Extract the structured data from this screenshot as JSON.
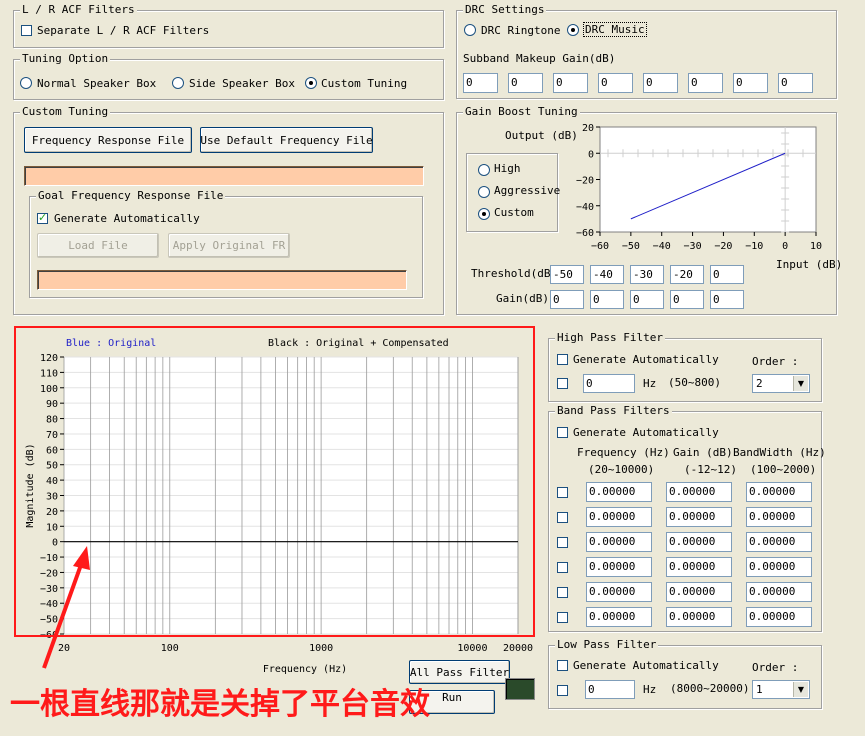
{
  "acf": {
    "legend": "L / R ACF Filters",
    "separate_label": "Separate L / R ACF Filters",
    "separate_checked": false
  },
  "tuning": {
    "legend": "Tuning Option",
    "options": [
      "Normal Speaker Box",
      "Side Speaker Box",
      "Custom Tuning"
    ],
    "selected": 2
  },
  "custom": {
    "legend": "Custom Tuning",
    "freq_file_btn": "Frequency Response File",
    "default_file_btn": "Use Default Frequency File",
    "goal_legend": "Goal Frequency Response File",
    "generate_label": "Generate Automatically",
    "generate_checked": true,
    "load_btn": "Load File",
    "apply_btn": "Apply Original FR"
  },
  "drc": {
    "legend": "DRC Settings",
    "options": [
      "DRC Ringtone",
      "DRC Music"
    ],
    "selected": 1,
    "subband_label": "Subband Makeup Gain(dB)",
    "subband_values": [
      "0",
      "0",
      "0",
      "0",
      "0",
      "0",
      "0",
      "0"
    ]
  },
  "gain_boost": {
    "legend": "Gain Boost Tuning",
    "options": [
      "High",
      "Aggressive",
      "Custom"
    ],
    "selected": 2,
    "threshold_label": "Threshold(dB)",
    "thresholds": [
      "-50",
      "-40",
      "-30",
      "-20",
      "0"
    ],
    "gain_label": "Gain(dB)",
    "gains": [
      "0",
      "0",
      "0",
      "0",
      "0"
    ]
  },
  "chart_data": [
    {
      "type": "line",
      "title": "",
      "xlabel": "Input (dB)",
      "ylabel": "Output (dB)",
      "xlim": [
        -60,
        10
      ],
      "ylim": [
        -60,
        20
      ],
      "xticks": [
        "−60",
        "−50",
        "−40",
        "−30",
        "−20",
        "−10",
        "0",
        "10"
      ],
      "yticks": [
        "20",
        "0",
        "−20",
        "−40",
        "−60"
      ],
      "series": [
        {
          "color": "#1f1fc8",
          "x": [
            -50,
            0
          ],
          "y": [
            -50,
            0
          ]
        }
      ]
    },
    {
      "type": "line",
      "xscale": "log",
      "xlabel": "Frequency (Hz)",
      "ylabel": "Magnitude (dB)",
      "xlim": [
        20,
        20000
      ],
      "ylim": [
        -60,
        120
      ],
      "xticks": [
        "20",
        "100",
        "1000",
        "10000",
        "20000"
      ],
      "yticks": [
        "120",
        "110",
        "100",
        "90",
        "80",
        "70",
        "60",
        "50",
        "40",
        "30",
        "20",
        "10",
        "0",
        "−10",
        "−20",
        "−30",
        "−40",
        "−50",
        "−60"
      ],
      "legend": {
        "blue": "Blue : Original",
        "black": "Black : Original + Compensated"
      },
      "series": [
        {
          "color": "#000000",
          "x": [
            20,
            20000
          ],
          "y": [
            0,
            0
          ]
        }
      ]
    }
  ],
  "hpf": {
    "legend": "High Pass Filter",
    "generate_label": "Generate Automatically",
    "order_label": "Order :",
    "value": "0",
    "unit": "Hz",
    "range": "(50~800)",
    "order": "2"
  },
  "bpf": {
    "legend": "Band Pass Filters",
    "generate_label": "Generate Automatically",
    "headers": [
      "Frequency (Hz)",
      "Gain (dB)",
      "BandWidth (Hz)"
    ],
    "ranges": [
      "(20~10000)",
      "(-12~12)",
      "(100~2000)"
    ],
    "rows": [
      [
        "0.00000",
        "0.00000",
        "0.00000"
      ],
      [
        "0.00000",
        "0.00000",
        "0.00000"
      ],
      [
        "0.00000",
        "0.00000",
        "0.00000"
      ],
      [
        "0.00000",
        "0.00000",
        "0.00000"
      ],
      [
        "0.00000",
        "0.00000",
        "0.00000"
      ],
      [
        "0.00000",
        "0.00000",
        "0.00000"
      ]
    ]
  },
  "lpf": {
    "legend": "Low Pass Filter",
    "generate_label": "Generate Automatically",
    "order_label": "Order :",
    "value": "0",
    "unit": "Hz",
    "range": "(8000~20000)",
    "order": "1"
  },
  "buttons": {
    "all_pass": "All Pass Filter",
    "run": "Run"
  },
  "annotation": {
    "text": "一根直线那就是关掉了平台音效",
    "color": "#ff1a1a"
  }
}
